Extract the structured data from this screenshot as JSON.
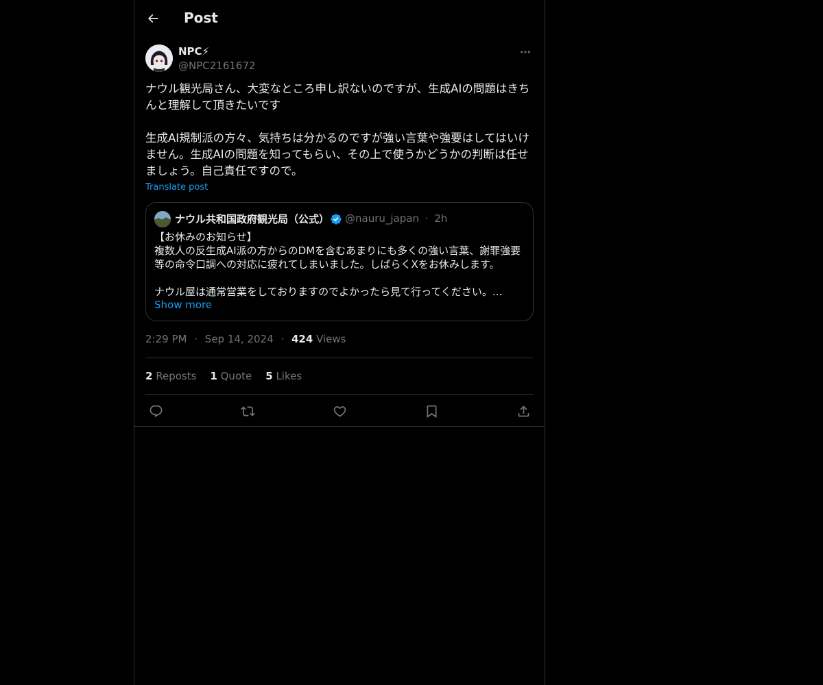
{
  "header": {
    "title": "Post"
  },
  "post": {
    "author_name": "NPC⚡",
    "author_handle": "@NPC2161672",
    "text": "ナウル観光局さん、大変なところ申し訳ないのですが、生成AIの問題はきちんと理解して頂きたいです\n\n生成AI規制派の方々、気持ちは分かるのですが強い言葉や強要はしてはいけません。生成AIの問題を知ってもらい、その上で使うかどうかの判断は任せましょう。自己責任ですので。",
    "translate_label": "Translate post",
    "time": "2:29 PM",
    "date": "Sep 14, 2024",
    "views_count": "424",
    "views_label": "Views",
    "separator": "·"
  },
  "quote": {
    "author_name": "ナウル共和国政府観光局（公式）",
    "author_handle": "@nauru_japan",
    "age": "2h",
    "separator": "·",
    "text": "【お休みのお知らせ】\n複数人の反生成AI派の方からのDMを含むあまりにも多くの強い言葉、謝罪強要等の命令口調への対応に疲れてしまいました。しばらくXをお休みします。\n\nナウル屋は通常営業をしておりますのでよかったら見て行ってください。...",
    "show_more_label": "Show more"
  },
  "stats": {
    "reposts_count": "2",
    "reposts_label": "Reposts",
    "quotes_count": "1",
    "quotes_label": "Quote",
    "likes_count": "5",
    "likes_label": "Likes"
  },
  "icons": {
    "back": "arrow-left-icon",
    "more": "more-icon",
    "verified": "verified-badge-icon",
    "reply": "reply-icon",
    "repost": "repost-icon",
    "like": "heart-icon",
    "bookmark": "bookmark-icon",
    "share": "share-icon"
  },
  "colors": {
    "accent": "#1d9bf0",
    "muted": "#71767b",
    "text": "#e7e9ea",
    "border": "#2f3336"
  }
}
